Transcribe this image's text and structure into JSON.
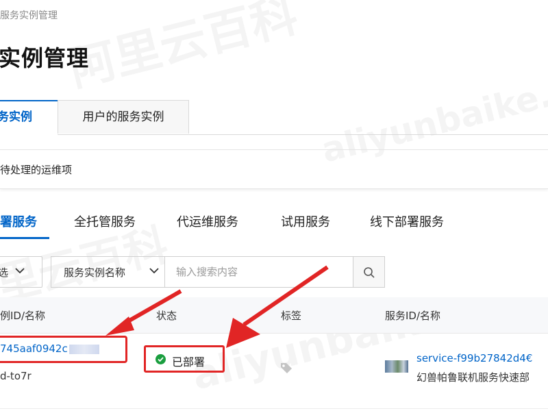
{
  "breadcrumb": "服务实例管理",
  "page_title": "实例管理",
  "top_tabs": [
    {
      "label": "务实例",
      "active": true
    },
    {
      "label": "用户的服务实例",
      "active": false
    }
  ],
  "todo_panel": {
    "text": "待处理的运维项"
  },
  "second_tabs": [
    {
      "label": "署服务",
      "active": true
    },
    {
      "label": "全托管服务",
      "active": false
    },
    {
      "label": "代运维服务",
      "active": false
    },
    {
      "label": "试用服务",
      "active": false
    },
    {
      "label": "线下部署服务",
      "active": false
    }
  ],
  "filter": {
    "label": "选",
    "select_label": "服务实例名称",
    "search_placeholder": "输入搜索内容"
  },
  "table": {
    "headers": [
      "例ID/名称",
      "状态",
      "标签",
      "服务ID/名称"
    ],
    "rows": [
      {
        "instance_id": "745aaf0942c",
        "instance_name": "d-to7r",
        "status": "已部署",
        "service_id": "service-f99b27842d4€",
        "service_name": "幻兽帕鲁联机服务快速部"
      }
    ]
  },
  "watermark": {
    "cn": "阿里云百科",
    "en": "aliyunbaike.com",
    "cn_short": "里云百科",
    "en_short": "aliyunbaike"
  },
  "colors": {
    "accent": "#0064c8",
    "success": "#1a9e3f",
    "annotation": "#e12525"
  }
}
